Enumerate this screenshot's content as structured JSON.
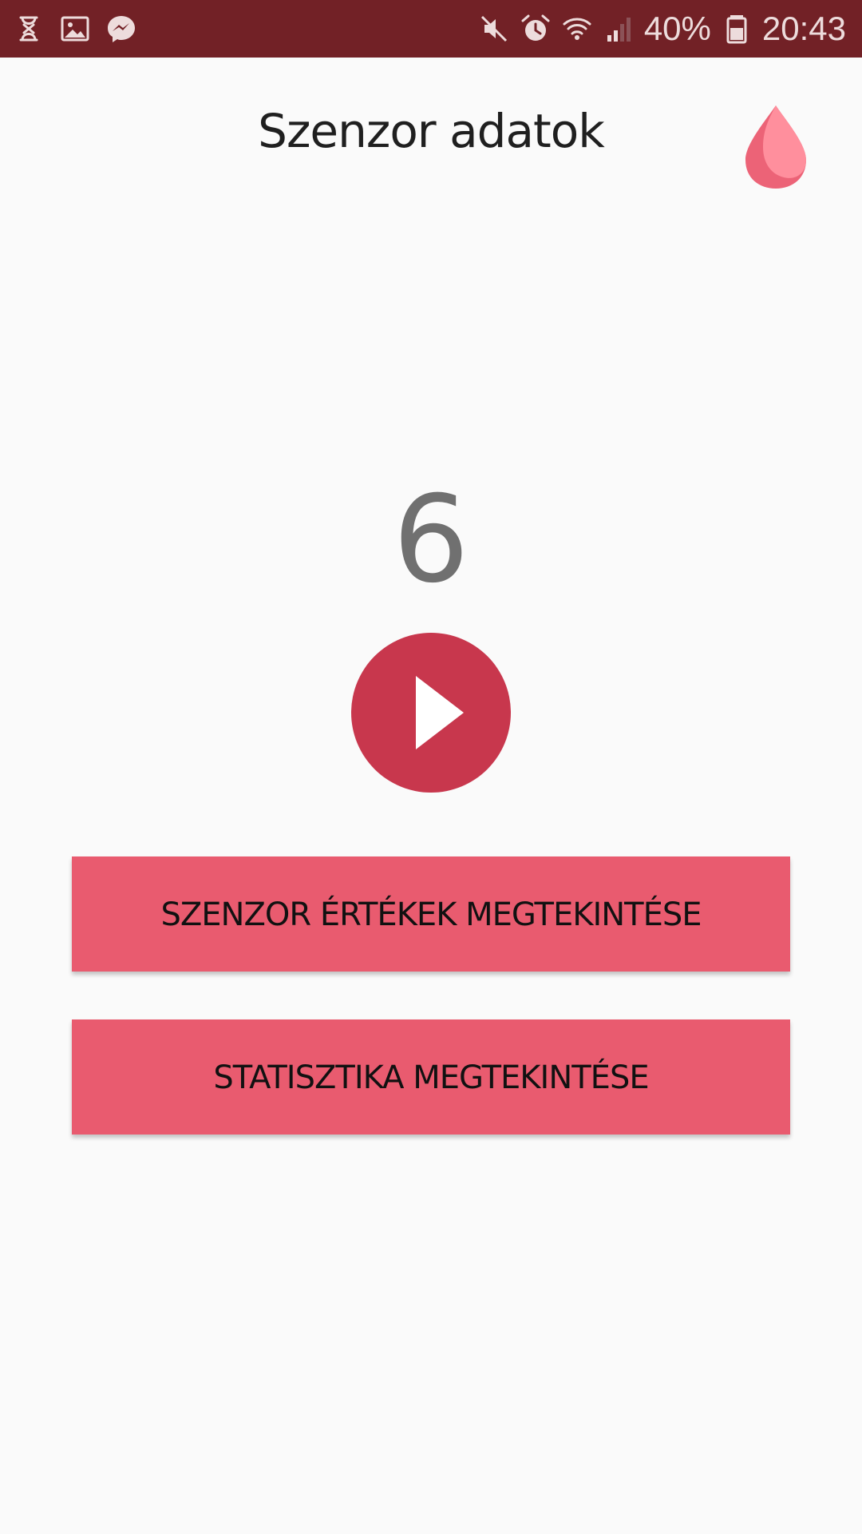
{
  "status_bar": {
    "battery_percent": "40%",
    "time": "20:43",
    "left_icons": [
      "hourglass-icon",
      "image-icon",
      "messenger-icon"
    ],
    "right_icons": [
      "mute-icon",
      "alarm-icon",
      "wifi-icon",
      "signal-icon",
      "battery-icon"
    ]
  },
  "header": {
    "title": "Szenzor adatok",
    "icon": "drop-icon"
  },
  "main": {
    "counter": "6",
    "play_icon": "play-icon",
    "buttons": {
      "sensor_values": "SZENZOR ÉRTÉKEK MEGTEKINTÉSE",
      "statistics": "STATISZTIKA MEGTEKINTÉSE"
    }
  },
  "colors": {
    "status_bar": "#722126",
    "background": "#fafafa",
    "play_button": "#c8374d",
    "action_button": "#e95b6f",
    "drop_dark": "#ec6377",
    "drop_light": "#ff8f9d"
  }
}
